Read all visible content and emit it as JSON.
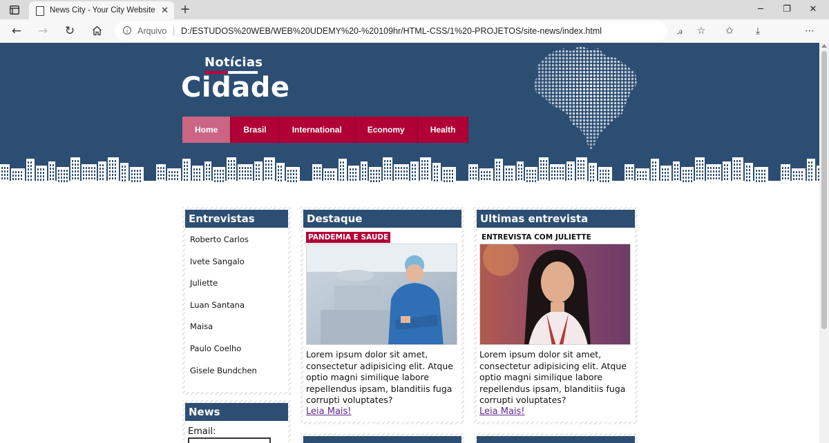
{
  "browser": {
    "tab_title": "News City - Your City Website",
    "new_tab": "+",
    "scheme_label": "Arquivo",
    "url_separator": "|",
    "url": "D:/ESTUDOS%20WEB/WEB%20UDEMY%20-%20109hr/HTML-CSS/1%20-PROJETOS/site-news/index.html"
  },
  "site": {
    "logo_small": "Notícias",
    "logo_big": "Cidade",
    "nav": [
      {
        "label": "Home",
        "active": true
      },
      {
        "label": "Brasil",
        "active": false
      },
      {
        "label": "International",
        "active": false
      },
      {
        "label": "Economy",
        "active": false
      },
      {
        "label": "Health",
        "active": false
      }
    ]
  },
  "sidebar": {
    "interviews_title": "Entrevistas",
    "interviews": [
      "Roberto Carlos",
      "Ivete Sangalo",
      "Juliette",
      "Luan Santana",
      "Maisa",
      "Paulo Coelho",
      "Gisele Bundchen"
    ],
    "news_title": "News",
    "email_label": "Email:"
  },
  "highlight": {
    "title": "Destaque",
    "tag": "PANDEMIA E SAUDE",
    "text": "Lorem ipsum dolor sit amet, consectetur adipisicing elit. Atque optio magni similique labore repellendus ipsam, blanditiis fuga corrupti voluptates?",
    "more": "Leia Mais!"
  },
  "latest": {
    "title": "Ultimas entrevista",
    "tag": "ENTREVISTA COM JULIETTE",
    "text": "Lorem ipsum dolor sit amet, consectetur adipisicing elit. Atque optio magni similique labore repellendus ipsam, blanditiis fuga corrupti voluptates?",
    "more": "Leia Mais!"
  },
  "colors": {
    "header_blue": "#2d4e73",
    "nav_red": "#b10035",
    "nav_active": "#cc6584",
    "link_purple": "#5c2a91"
  },
  "icons": [
    "browser-layout-icon",
    "page-favicon",
    "close-icon",
    "back-icon",
    "forward-icon",
    "refresh-icon",
    "home-icon",
    "info-icon",
    "read-aloud-icon",
    "add-favorite-icon",
    "favorites-icon",
    "downloads-icon",
    "profile-avatar",
    "more-icon",
    "minimize-icon",
    "maximize-icon",
    "window-close-icon"
  ]
}
